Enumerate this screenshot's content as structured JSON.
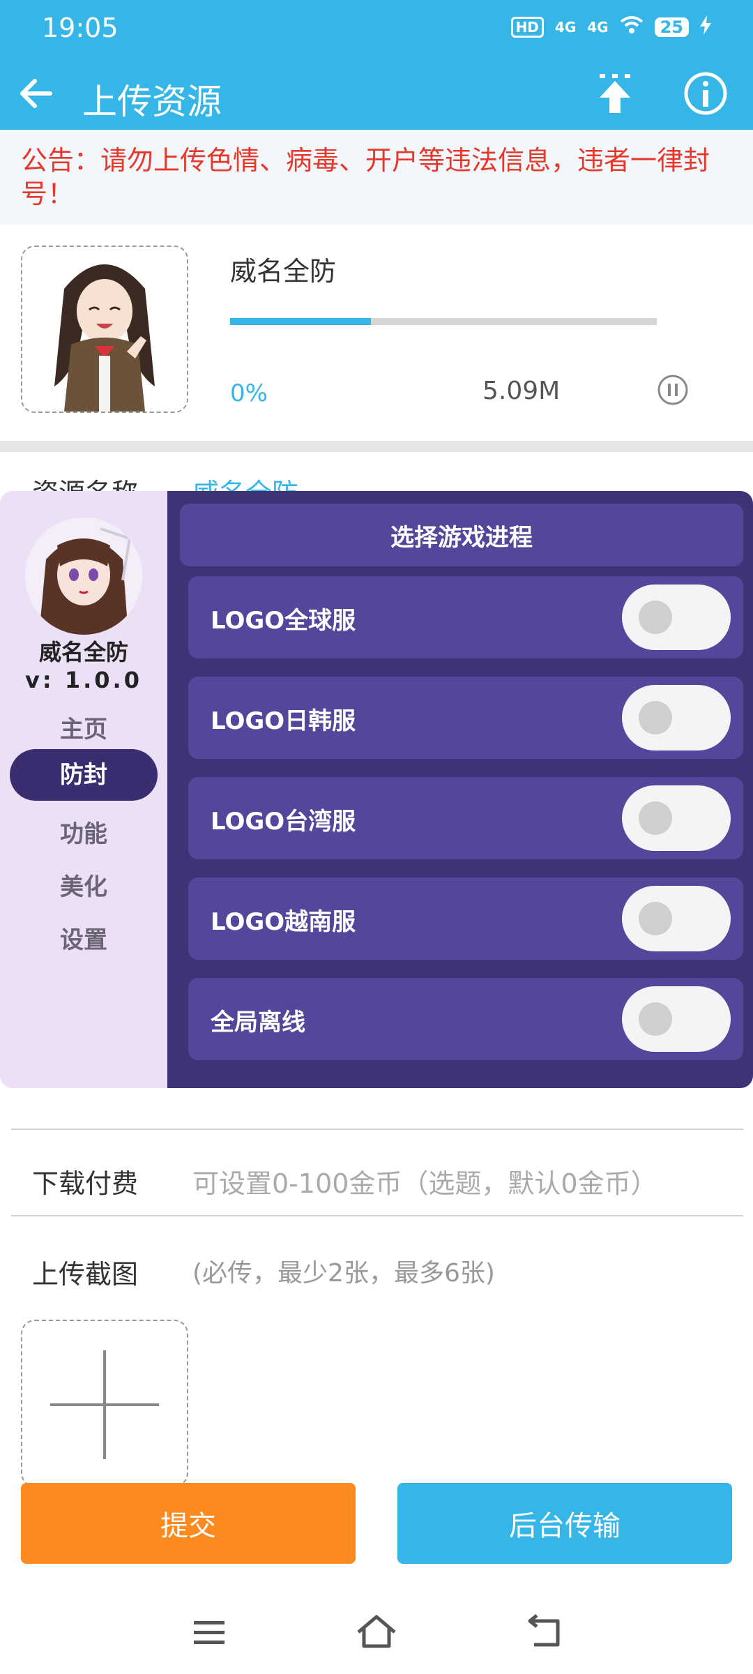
{
  "status_bar": {
    "time": "19:05",
    "hd_label": "HD",
    "signal1": "4G",
    "signal2": "4G",
    "battery": "25"
  },
  "app_bar": {
    "title": "上传资源",
    "back_icon": "arrow-left-icon",
    "upload_icon": "upload-icon",
    "info_icon": "info-icon"
  },
  "notice": {
    "text": "公告：请勿上传色情、病毒、开户等违法信息，违者一律封号！"
  },
  "resource": {
    "name": "威名全防",
    "progress_percent_label": "0%",
    "progress_fill": 0.33,
    "size": "5.09M"
  },
  "fields": {
    "resource_name_label": "资源名称",
    "resource_name_value": "威名全防",
    "download_fee_label": "下载付费",
    "download_fee_placeholder": "可设置0-100金币（选题，默认0金币）",
    "screenshot_label": "上传截图",
    "screenshot_hint": "(必传，最少2张，最多6张)"
  },
  "buttons": {
    "submit": "提交",
    "background": "后台传输"
  },
  "overlay": {
    "app_name": "威名全防",
    "version": "v: 1.0.0",
    "nav": [
      "主页",
      "防封",
      "功能",
      "美化",
      "设置"
    ],
    "active_nav": "防封",
    "header": "选择游戏进程",
    "options": [
      {
        "label": "LOGO全球服",
        "on": false
      },
      {
        "label": "LOGO日韩服",
        "on": false
      },
      {
        "label": "LOGO台湾服",
        "on": false
      },
      {
        "label": "LOGO越南服",
        "on": false
      },
      {
        "label": "全局离线",
        "on": false
      }
    ]
  },
  "colors": {
    "primary": "#35b6e7",
    "notice_text": "#e53a2b",
    "submit": "#fd8a1f",
    "overlay_main": "#3f3275",
    "overlay_item": "#52479a",
    "overlay_side": "#ece0f6"
  }
}
